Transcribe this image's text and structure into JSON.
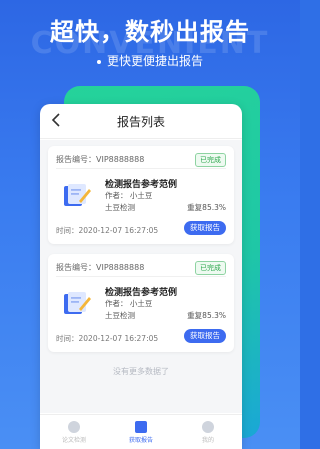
{
  "promo": {
    "watermark": "CONVENIENT",
    "headline": "超快，数秒出报告",
    "subline": "更快更便捷出报告"
  },
  "nav": {
    "title": "报告列表"
  },
  "reports": [
    {
      "number": "报告编号：VIP8888888",
      "status": "已完成",
      "title": "检测报告参考范例",
      "author": "作者：   小土豆",
      "school": "土豆检测",
      "duplicate": "重复85.3%",
      "time": "时间：2020-12-07 16:27:05",
      "action": "获取报告"
    },
    {
      "number": "报告编号：VIP8888888",
      "status": "已完成",
      "title": "检测报告参考范例",
      "author": "作者：   小土豆",
      "school": "土豆检测",
      "duplicate": "重复85.3%",
      "time": "时间：2020-12-07 16:27:05",
      "action": "获取报告"
    }
  ],
  "list_footer": "没有更多数据了",
  "tabs": [
    {
      "label": "论文检测",
      "icon": "shield-icon"
    },
    {
      "label": "获取报告",
      "icon": "document-icon",
      "active": true
    },
    {
      "label": "我的",
      "icon": "user-icon"
    }
  ],
  "colors": {
    "accent": "#3d6bf0",
    "background": "#2f6fe6",
    "green": "#25d39a"
  }
}
